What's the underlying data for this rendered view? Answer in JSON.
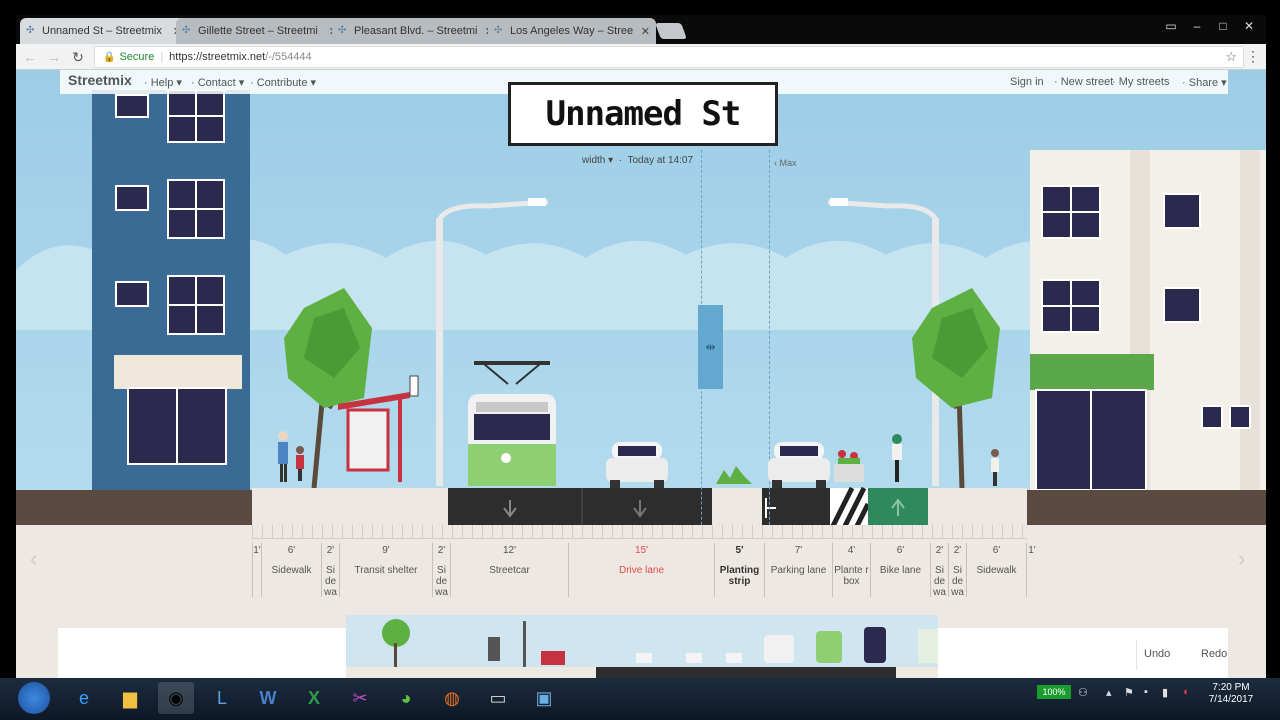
{
  "browser": {
    "tabs": [
      {
        "label": "Unnamed St – Streetmix",
        "active": true
      },
      {
        "label": "Gillette Street – Streetmi",
        "active": false
      },
      {
        "label": "Pleasant Blvd. – Streetmi",
        "active": false
      },
      {
        "label": "Los Angeles Way – Stree",
        "active": false
      }
    ],
    "secure_label": "Secure",
    "url_host": "https://streetmix.net",
    "url_path": "/-/554444"
  },
  "app": {
    "logo": "Streetmix",
    "nav_left": [
      "Help",
      "Contact",
      "Contribute"
    ],
    "nav_right": [
      "Sign in",
      "New street",
      "My streets",
      "Share"
    ],
    "street_name": "Unnamed St",
    "width_menu": "width",
    "timestamp": "Today at 14:07",
    "max_label": "‹ Max"
  },
  "segments": [
    {
      "width": "1'",
      "name": ""
    },
    {
      "width": "6'",
      "name": "Sidewalk"
    },
    {
      "width": "2'",
      "name": "Si de wa"
    },
    {
      "width": "9'",
      "name": "Transit shelter"
    },
    {
      "width": "2'",
      "name": "Si de wa"
    },
    {
      "width": "12'",
      "name": "Streetcar"
    },
    {
      "width": "15'",
      "name": "Drive lane",
      "selected": true
    },
    {
      "width": "5'",
      "name": "Planting strip",
      "bold": true
    },
    {
      "width": "7'",
      "name": "Parking lane"
    },
    {
      "width": "4'",
      "name": "Plante r box"
    },
    {
      "width": "6'",
      "name": "Bike lane"
    },
    {
      "width": "2'",
      "name": "Si de wa"
    },
    {
      "width": "2'",
      "name": "Si de wa"
    },
    {
      "width": "6'",
      "name": "Sidewalk"
    },
    {
      "width": "1'",
      "name": ""
    }
  ],
  "actions": {
    "undo": "Undo",
    "redo": "Redo"
  },
  "taskbar": {
    "battery": "100%",
    "time": "7:20 PM",
    "date": "7/14/2017"
  },
  "colors": {
    "sky": "#9ccde6",
    "road": "#2d2d2d",
    "sidewalk": "#ede8e2",
    "streetcar_lane": "#2d2d2d",
    "bike_lane": "#2e8a5b",
    "building_blue": "#3a6b95",
    "selected_segment": "#e34a4a"
  }
}
